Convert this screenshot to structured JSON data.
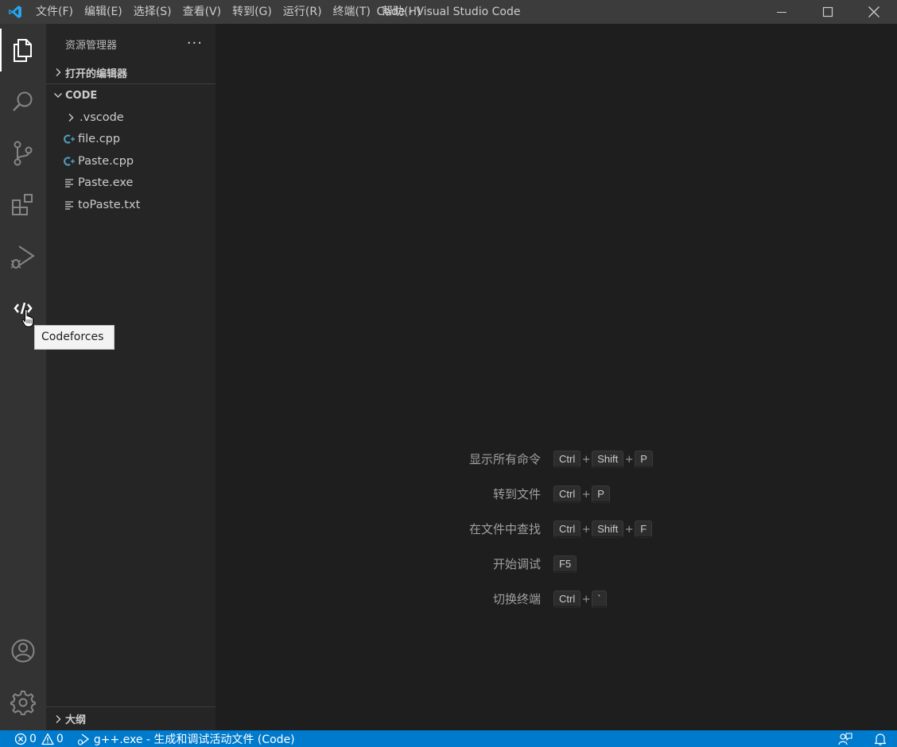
{
  "titlebar": {
    "menu": [
      "文件(F)",
      "编辑(E)",
      "选择(S)",
      "查看(V)",
      "转到(G)",
      "运行(R)",
      "终端(T)",
      "帮助(H)"
    ],
    "window_title": "Code - Visual Studio Code"
  },
  "activitybar": {
    "items": [
      "files-icon",
      "search-icon",
      "source-control-icon",
      "extensions-icon",
      "run-debug-icon",
      "codeforces-icon"
    ],
    "bottom": [
      "account-icon",
      "settings-gear-icon"
    ],
    "tooltip": "Codeforces"
  },
  "sidebar": {
    "title": "资源管理器",
    "more": "···",
    "open_editors_label": "打开的编辑器",
    "folder_label": "CODE",
    "files": [
      {
        "name": ".vscode",
        "kind": "folder"
      },
      {
        "name": "file.cpp",
        "kind": "cpp"
      },
      {
        "name": "Paste.cpp",
        "kind": "cpp"
      },
      {
        "name": "Paste.exe",
        "kind": "text"
      },
      {
        "name": "toPaste.txt",
        "kind": "text"
      }
    ],
    "outline_label": "大纲"
  },
  "shortcuts": [
    {
      "label": "显示所有命令",
      "keys": [
        "Ctrl",
        "Shift",
        "P"
      ]
    },
    {
      "label": "转到文件",
      "keys": [
        "Ctrl",
        "P"
      ]
    },
    {
      "label": "在文件中查找",
      "keys": [
        "Ctrl",
        "Shift",
        "F"
      ]
    },
    {
      "label": "开始调试",
      "keys": [
        "F5"
      ]
    },
    {
      "label": "切换终端",
      "keys": [
        "Ctrl",
        "`"
      ]
    }
  ],
  "statusbar": {
    "errors": "0",
    "warnings": "0",
    "task": "g++.exe - 生成和调试活动文件 (Code)"
  },
  "colors": {
    "accent": "#007acc",
    "titlebar": "#3c3c3c",
    "activitybar": "#333333",
    "sidebar": "#252526",
    "editor": "#1e1e1e",
    "cpp_icon": "#519aba"
  }
}
